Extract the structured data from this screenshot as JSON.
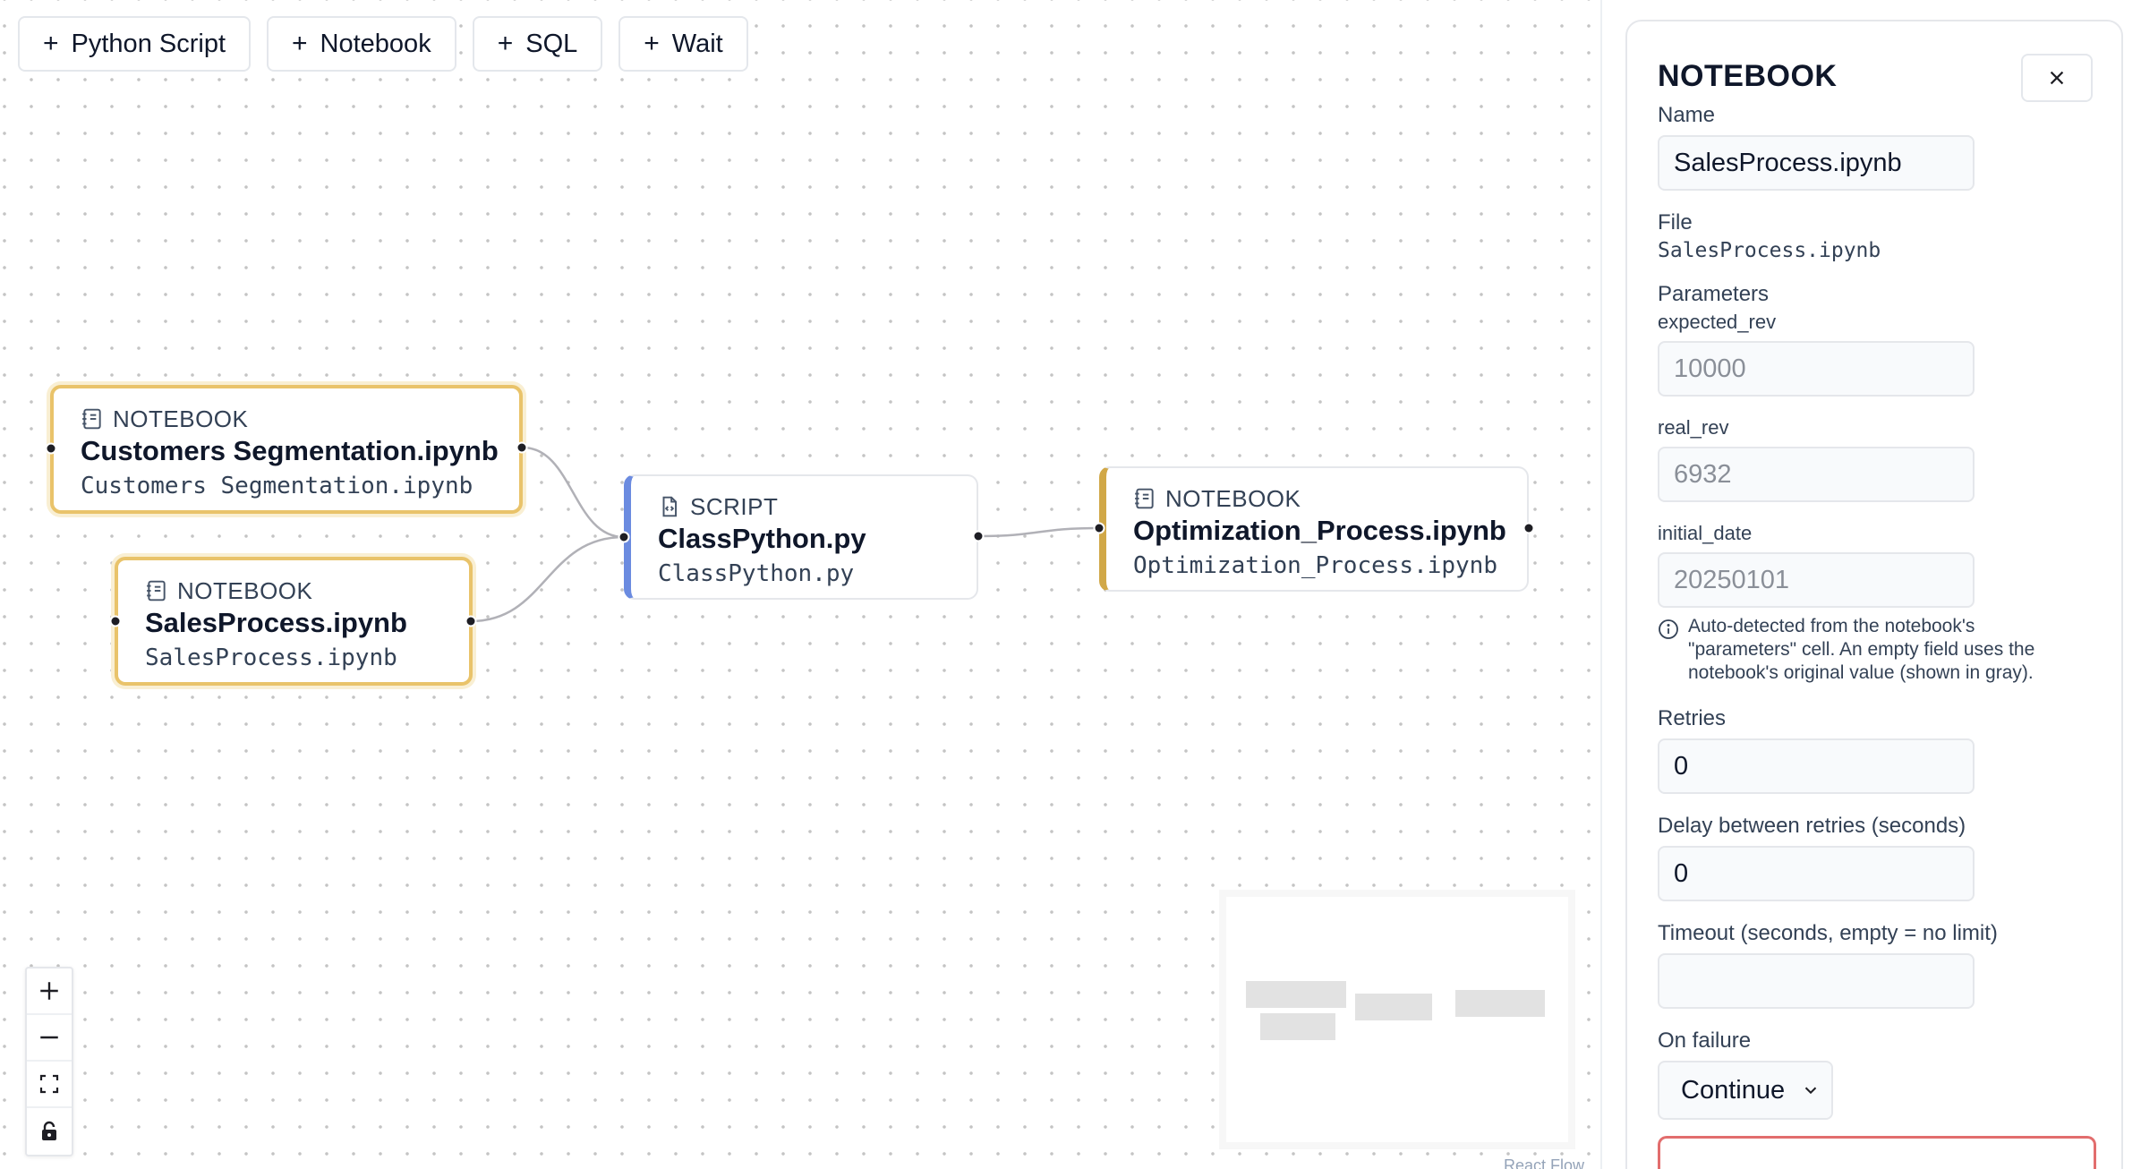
{
  "toolbar": {
    "buttons": [
      {
        "label": "Python Script"
      },
      {
        "label": "Notebook"
      },
      {
        "label": "SQL"
      },
      {
        "label": "Wait"
      }
    ]
  },
  "nodes": {
    "customers": {
      "kind": "NOTEBOOK",
      "title": "Customers Segmentation.ipynb",
      "file": "Customers Segmentation.ipynb"
    },
    "sales": {
      "kind": "NOTEBOOK",
      "title": "SalesProcess.ipynb",
      "file": "SalesProcess.ipynb"
    },
    "script": {
      "kind": "SCRIPT",
      "title": "ClassPython.py",
      "file": "ClassPython.py"
    },
    "optimization": {
      "kind": "NOTEBOOK",
      "title": "Optimization_Process.ipynb",
      "file": "Optimization_Process.ipynb"
    }
  },
  "canvas": {
    "attribution": "React Flow",
    "controls": [
      "zoom-in-icon",
      "zoom-out-icon",
      "fit-view-icon",
      "lock-icon"
    ]
  },
  "panel": {
    "title": "NOTEBOOK",
    "name_label": "Name",
    "name_value": "SalesProcess.ipynb",
    "file_label": "File",
    "file_value": "SalesProcess.ipynb",
    "parameters_label": "Parameters",
    "parameters": [
      {
        "name": "expected_rev",
        "placeholder": "10000"
      },
      {
        "name": "real_rev",
        "placeholder": "6932"
      },
      {
        "name": "initial_date",
        "placeholder": "20250101"
      }
    ],
    "hint": "Auto-detected from the notebook's \"parameters\" cell. An empty field uses the notebook's original value (shown in gray).",
    "retries_label": "Retries",
    "retries_value": "0",
    "delay_label": "Delay between retries (seconds)",
    "delay_value": "0",
    "timeout_label": "Timeout (seconds, empty = no limit)",
    "timeout_value": "",
    "on_failure_label": "On failure",
    "on_failure_value": "Continue"
  },
  "colors": {
    "script_accent": "#6b8be0",
    "notebook_accent": "#d1a848",
    "selected_border": "#e9c36a",
    "danger": "#e26d6d"
  }
}
